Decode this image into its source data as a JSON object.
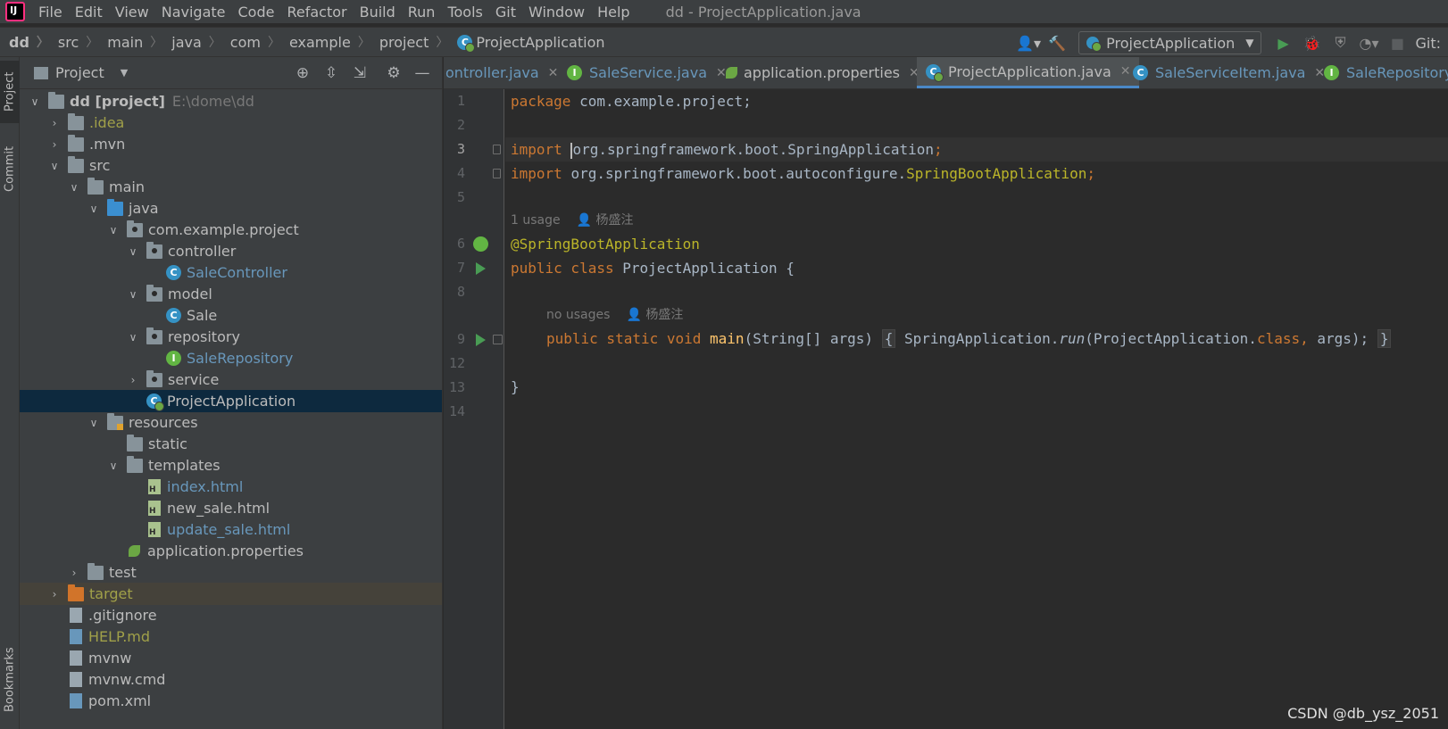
{
  "window": {
    "title": "dd - ProjectApplication.java"
  },
  "menu": [
    "File",
    "Edit",
    "View",
    "Navigate",
    "Code",
    "Refactor",
    "Build",
    "Run",
    "Tools",
    "Git",
    "Window",
    "Help"
  ],
  "breadcrumb": [
    "dd",
    "src",
    "main",
    "java",
    "com",
    "example",
    "project",
    "ProjectApplication"
  ],
  "toolbar": {
    "run_config": "ProjectApplication",
    "git_label": "Git:"
  },
  "side_tabs": {
    "project": "Project",
    "commit": "Commit",
    "bookmarks": "Bookmarks"
  },
  "project_panel": {
    "title": "Project",
    "root_name": "dd [project]",
    "root_path": "E:\\dome\\dd",
    "tree": [
      ".idea",
      ".mvn",
      "src",
      "main",
      "java",
      "com.example.project",
      "controller",
      "SaleController",
      "model",
      "Sale",
      "repository",
      "SaleRepository",
      "service",
      "ProjectApplication",
      "resources",
      "static",
      "templates",
      "index.html",
      "new_sale.html",
      "update_sale.html",
      "application.properties",
      "test",
      "target",
      ".gitignore",
      "HELP.md",
      "mvnw",
      "mvnw.cmd",
      "pom.xml"
    ]
  },
  "tabs": [
    "ontroller.java",
    "SaleService.java",
    "application.properties",
    "ProjectApplication.java",
    "SaleServiceItem.java",
    "SaleRepository.j"
  ],
  "code": {
    "line_numbers": [
      "1",
      "2",
      "3",
      "4",
      "5",
      "6",
      "7",
      "8",
      "9",
      "12",
      "13",
      "14"
    ],
    "l1_kw": "package",
    "l1_rest": " com.example.project;",
    "l3_kw": "import",
    "l3_pkg": "org.springframework.boot.",
    "l3_cls": "SpringApplication",
    "l3_semi": ";",
    "l4_kw": "import",
    "l4_pkg": "org.springframework.boot.autoconfigure.",
    "l4_cls": "SpringBootApplication",
    "l4_semi": ";",
    "hint1_usage": "1 usage",
    "hint1_author": "杨盛注",
    "l6_annotation": "@SpringBootApplication",
    "l7_kw": "public class",
    "l7_name": "ProjectApplication",
    "l7_brace": " {",
    "hint2_usage": "no usages",
    "hint2_author": "杨盛注",
    "l9_kw": "public static void",
    "l9_fn": "main",
    "l9_params": "(String[] args)",
    "l9_open": "{",
    "l9_cls": " SpringApplication.",
    "l9_run": "run",
    "l9_arg1": "(ProjectApplication.",
    "l9_classkw": "class",
    "l9_comma": ",",
    "l9_arg2": " args);",
    "l9_close": "}",
    "l13": "}"
  },
  "watermark": "CSDN @db_ysz_2051"
}
